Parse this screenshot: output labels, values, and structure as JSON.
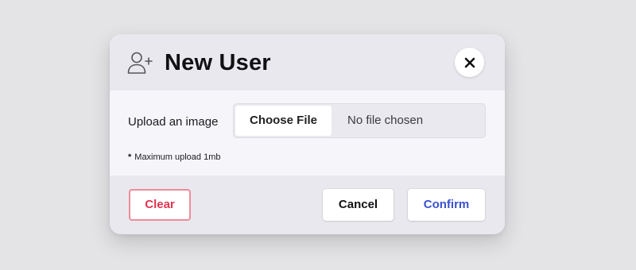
{
  "dialog": {
    "title": "New User",
    "title_icon": "user-plus-icon",
    "close_icon": "close-icon"
  },
  "upload": {
    "label": "Upload an image",
    "choose_button_label": "Choose File",
    "status_text": "No file chosen",
    "note_marker": "*",
    "note_text": "Maximum upload 1mb"
  },
  "footer": {
    "clear_label": "Clear",
    "cancel_label": "Cancel",
    "confirm_label": "Confirm"
  },
  "colors": {
    "page_background": "#e4e4e7",
    "header_background": "#e8e8ee",
    "body_background": "#f6f6fa",
    "clear_text": "#e2344f",
    "clear_border": "#ef8b9b",
    "confirm_text": "#3a51d0"
  }
}
